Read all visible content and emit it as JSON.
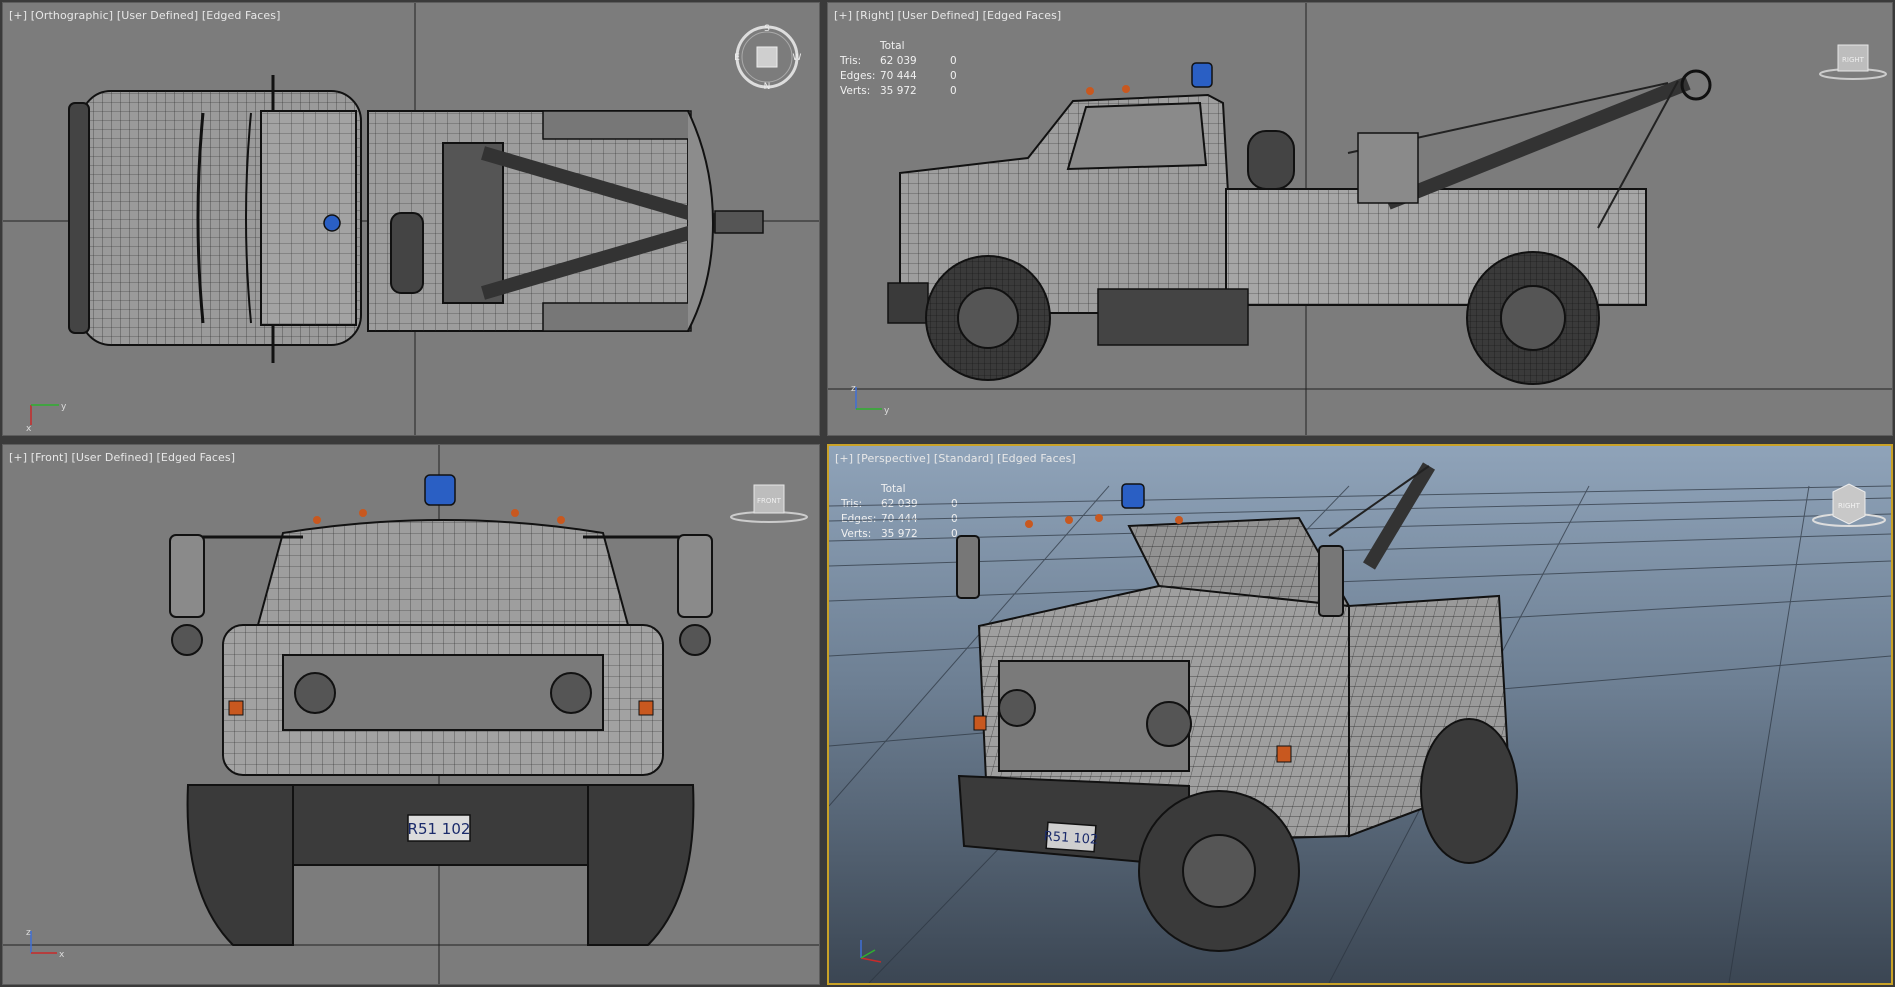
{
  "viewports": {
    "top": {
      "labels": [
        "[+]",
        "[Orthographic]",
        "[User Defined]",
        "[Edged Faces]"
      ],
      "axis_x": "y",
      "axis_y": "x"
    },
    "right": {
      "labels": [
        "[+]",
        "[Right]",
        "[User Defined]",
        "[Edged Faces]"
      ],
      "axis_x": "y",
      "axis_y": "z",
      "cube_label": "RIGHT"
    },
    "front": {
      "labels": [
        "[+]",
        "[Front]",
        "[User Defined]",
        "[Edged Faces]"
      ],
      "axis_x": "x",
      "axis_y": "z",
      "cube_label": "FRONT"
    },
    "perspective": {
      "labels": [
        "[+]",
        "[Perspective]",
        "[Standard]",
        "[Edged Faces]"
      ],
      "cube_label": "RIGHT"
    }
  },
  "stats": {
    "header": "Total",
    "rows": [
      {
        "label": "Tris:",
        "value": "62 039",
        "sel": "0"
      },
      {
        "label": "Edges:",
        "value": "70 444",
        "sel": "0"
      },
      {
        "label": "Verts:",
        "value": "35 972",
        "sel": "0"
      }
    ]
  },
  "license_plate": "R51 102",
  "compass": {
    "n": "N",
    "s": "S",
    "e": "E",
    "w": "W"
  },
  "colors": {
    "viewport_bg": "#7c7c7c",
    "active_border": "#c9a227",
    "light_blue": "#2a5fc4",
    "marker_orange": "#c8581f"
  }
}
